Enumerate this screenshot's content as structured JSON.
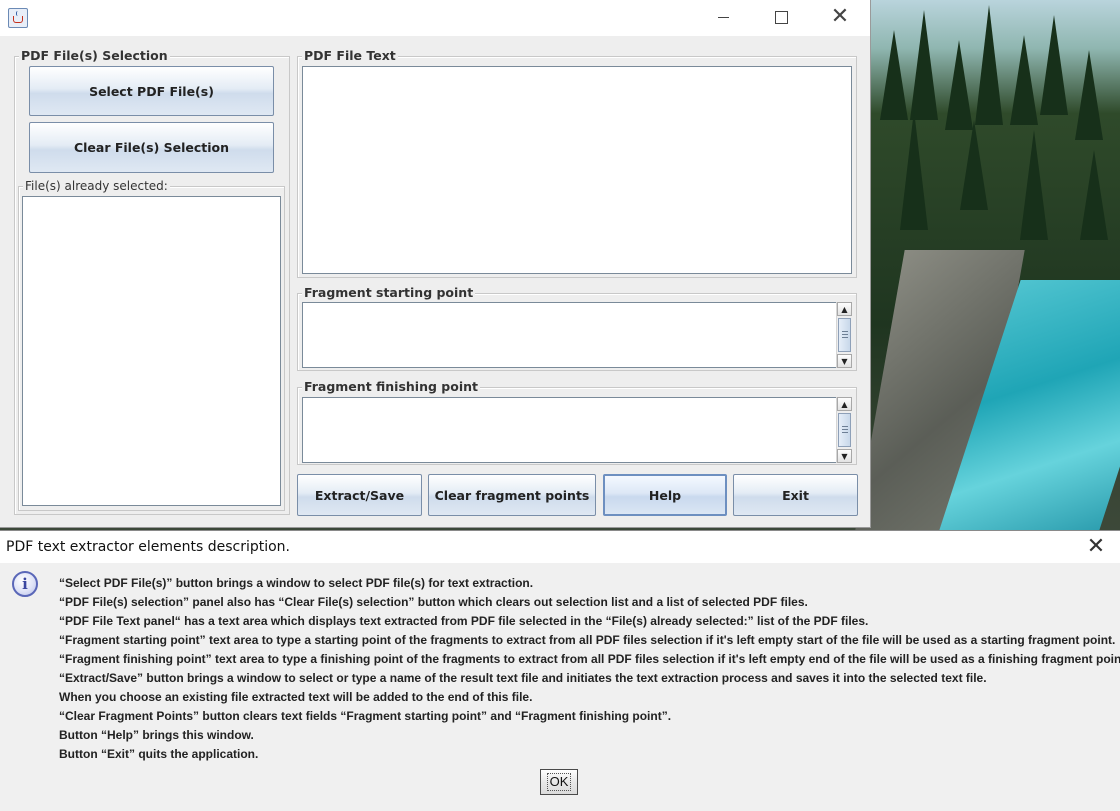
{
  "app": {
    "window_controls": {
      "minimize": "—",
      "maximize": "□",
      "close": "✕"
    },
    "selection_panel": {
      "title": "PDF File(s) Selection",
      "select_button": "Select PDF File(s)",
      "clear_button": "Clear File(s) Selection",
      "list_title": "File(s) already selected:"
    },
    "text_panel": {
      "title": "PDF File Text"
    },
    "fragment_start": {
      "title": "Fragment starting point"
    },
    "fragment_finish": {
      "title": "Fragment finishing point"
    },
    "actions": {
      "extract_save": "Extract/Save",
      "clear_fragment": "Clear fragment points",
      "help": "Help",
      "exit": "Exit"
    }
  },
  "dialog": {
    "title": "PDF text extractor elements description.",
    "close": "✕",
    "lines": [
      "“Select PDF File(s)” button brings a window to select PDF file(s) for text extraction.",
      "“PDF File(s) selection” panel also has “Clear File(s) selection” button which clears out selection list and a list of selected PDF files.",
      "“PDF File Text panel“ has a text area which displays text extracted from PDF file selected in the “File(s) already selected:” list of the PDF files.",
      "“Fragment starting point” text area to type a starting point of the fragments to extract from all PDF files selection if it's left empty start of the file will be used as a starting fragment point.",
      "“Fragment finishing point” text area to type a finishing point of the fragments to extract from all PDF files selection if it's left empty end of the file will be used as a finishing fragment point.",
      "“Extract/Save” button brings a window to select or type a name of the result text file and initiates the text extraction process and saves it into the selected text file.",
      "When you choose an existing file extracted text will be added to the end of this file.",
      "“Clear Fragment Points” button clears text fields “Fragment starting point” and “Fragment finishing point”.",
      "Button “Help” brings this window.",
      "Button “Exit” quits the application."
    ],
    "ok_label": "OK"
  },
  "icons": {
    "app": "java-icon",
    "dialog": "info-icon"
  }
}
